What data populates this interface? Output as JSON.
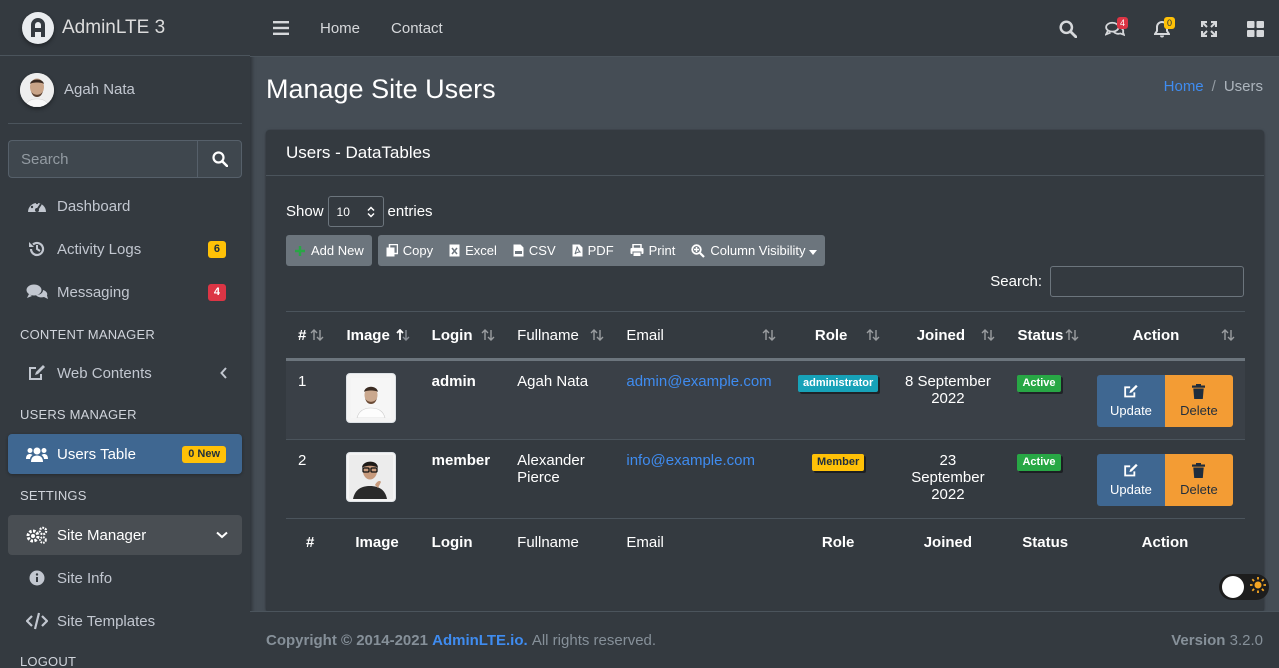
{
  "brand": {
    "name": "AdminLTE 3"
  },
  "user": {
    "name": "Agah Nata"
  },
  "sidebar": {
    "search_placeholder": "Search",
    "items": [
      {
        "label": "Dashboard"
      },
      {
        "label": "Activity Logs",
        "badge": "6"
      },
      {
        "label": "Messaging",
        "badge": "4"
      },
      {
        "label": "Web Contents"
      },
      {
        "label": "Users Table",
        "badge": "0 New"
      },
      {
        "label": "Site Manager"
      },
      {
        "label": "Site Info"
      },
      {
        "label": "Site Templates"
      }
    ],
    "headers": [
      "CONTENT MANAGER",
      "USERS MANAGER",
      "SETTINGS",
      "LOGOUT"
    ]
  },
  "topbar": {
    "links": [
      "Home",
      "Contact"
    ],
    "messages_badge": "4",
    "notifications_badge": "0"
  },
  "page": {
    "title": "Manage Site Users",
    "breadcrumb_home": "Home",
    "breadcrumb_sep": "/",
    "breadcrumb_current": "Users"
  },
  "card": {
    "title": "Users - DataTables",
    "show_label": "Show",
    "entries_value": "10",
    "entries_label": "entries",
    "search_label": "Search:",
    "buttons": {
      "add": "Add New",
      "copy": "Copy",
      "excel": "Excel",
      "csv": "CSV",
      "pdf": "PDF",
      "print": "Print",
      "colvis": "Column Visibility"
    }
  },
  "table": {
    "headers": [
      "#",
      "Image",
      "Login",
      "Fullname",
      "Email",
      "Role",
      "Joined",
      "Status",
      "Action"
    ],
    "rows": [
      {
        "num": "1",
        "login": "admin",
        "fullname": "Agah Nata",
        "email": "admin@example.com",
        "role": "administrator",
        "role_color": "#17a2b8",
        "joined": "8 September 2022",
        "status": "Active",
        "update": "Update",
        "delete": "Delete"
      },
      {
        "num": "2",
        "login": "member",
        "fullname": "Alexander Pierce",
        "email": "info@example.com",
        "role": "Member",
        "role_color": "#ffc107",
        "joined": "23 September 2022",
        "status": "Active",
        "update": "Update",
        "delete": "Delete"
      }
    ]
  },
  "footer": {
    "copyright": "Copyright © 2014-2021",
    "link": "AdminLTE.io.",
    "rights": "All rights reserved.",
    "version_label": "Version",
    "version": "3.2.0"
  },
  "colors": {
    "accent": "#3f6791",
    "link": "#3f8cf0",
    "warning": "#ffc107",
    "danger": "#dc3545",
    "success": "#28a745",
    "info": "#17a2b8"
  },
  "icons": [
    "hamburger-icon",
    "search-icon",
    "comments-icon",
    "bell-icon",
    "expand-icon",
    "th-large-icon",
    "dashboard-icon",
    "history-icon",
    "comments-icon",
    "edit-icon",
    "users-icon",
    "cogs-icon",
    "info-circle-icon",
    "code-icon",
    "plus-icon",
    "copy-icon",
    "excel-icon",
    "csv-icon",
    "pdf-icon",
    "print-icon",
    "search-plus-icon",
    "sort-icon",
    "trash-icon",
    "sun-icon"
  ]
}
